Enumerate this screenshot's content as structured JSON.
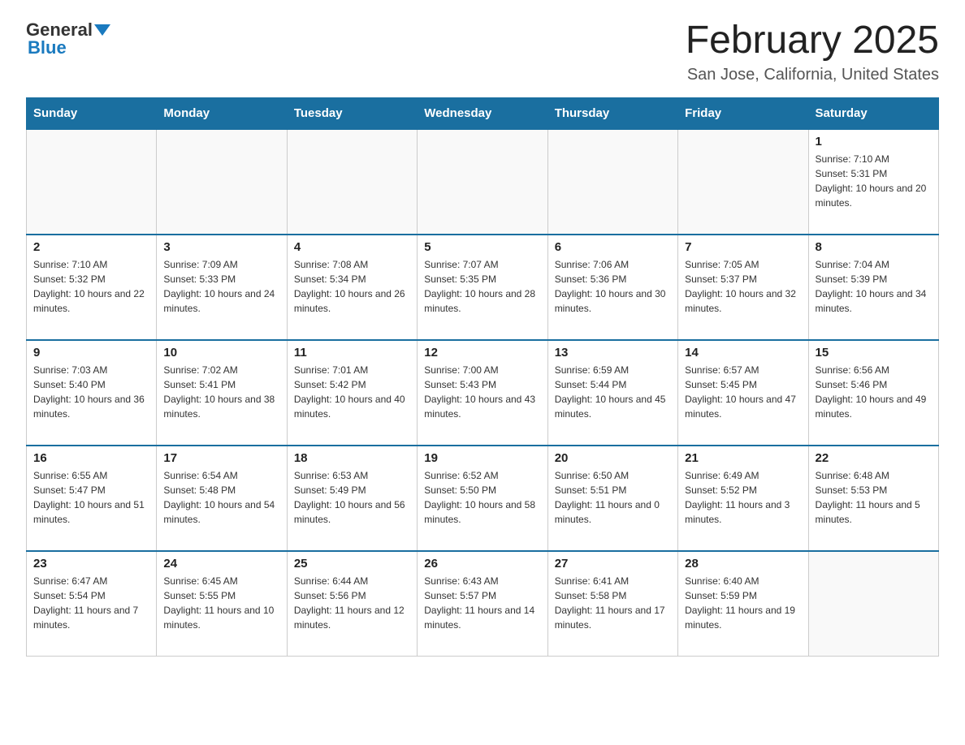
{
  "logo": {
    "general": "General",
    "triangle": "",
    "blue_label": "Blue"
  },
  "title": "February 2025",
  "subtitle": "San Jose, California, United States",
  "days_of_week": [
    "Sunday",
    "Monday",
    "Tuesday",
    "Wednesday",
    "Thursday",
    "Friday",
    "Saturday"
  ],
  "weeks": [
    [
      {
        "day": "",
        "sunrise": "",
        "sunset": "",
        "daylight": ""
      },
      {
        "day": "",
        "sunrise": "",
        "sunset": "",
        "daylight": ""
      },
      {
        "day": "",
        "sunrise": "",
        "sunset": "",
        "daylight": ""
      },
      {
        "day": "",
        "sunrise": "",
        "sunset": "",
        "daylight": ""
      },
      {
        "day": "",
        "sunrise": "",
        "sunset": "",
        "daylight": ""
      },
      {
        "day": "",
        "sunrise": "",
        "sunset": "",
        "daylight": ""
      },
      {
        "day": "1",
        "sunrise": "Sunrise: 7:10 AM",
        "sunset": "Sunset: 5:31 PM",
        "daylight": "Daylight: 10 hours and 20 minutes."
      }
    ],
    [
      {
        "day": "2",
        "sunrise": "Sunrise: 7:10 AM",
        "sunset": "Sunset: 5:32 PM",
        "daylight": "Daylight: 10 hours and 22 minutes."
      },
      {
        "day": "3",
        "sunrise": "Sunrise: 7:09 AM",
        "sunset": "Sunset: 5:33 PM",
        "daylight": "Daylight: 10 hours and 24 minutes."
      },
      {
        "day": "4",
        "sunrise": "Sunrise: 7:08 AM",
        "sunset": "Sunset: 5:34 PM",
        "daylight": "Daylight: 10 hours and 26 minutes."
      },
      {
        "day": "5",
        "sunrise": "Sunrise: 7:07 AM",
        "sunset": "Sunset: 5:35 PM",
        "daylight": "Daylight: 10 hours and 28 minutes."
      },
      {
        "day": "6",
        "sunrise": "Sunrise: 7:06 AM",
        "sunset": "Sunset: 5:36 PM",
        "daylight": "Daylight: 10 hours and 30 minutes."
      },
      {
        "day": "7",
        "sunrise": "Sunrise: 7:05 AM",
        "sunset": "Sunset: 5:37 PM",
        "daylight": "Daylight: 10 hours and 32 minutes."
      },
      {
        "day": "8",
        "sunrise": "Sunrise: 7:04 AM",
        "sunset": "Sunset: 5:39 PM",
        "daylight": "Daylight: 10 hours and 34 minutes."
      }
    ],
    [
      {
        "day": "9",
        "sunrise": "Sunrise: 7:03 AM",
        "sunset": "Sunset: 5:40 PM",
        "daylight": "Daylight: 10 hours and 36 minutes."
      },
      {
        "day": "10",
        "sunrise": "Sunrise: 7:02 AM",
        "sunset": "Sunset: 5:41 PM",
        "daylight": "Daylight: 10 hours and 38 minutes."
      },
      {
        "day": "11",
        "sunrise": "Sunrise: 7:01 AM",
        "sunset": "Sunset: 5:42 PM",
        "daylight": "Daylight: 10 hours and 40 minutes."
      },
      {
        "day": "12",
        "sunrise": "Sunrise: 7:00 AM",
        "sunset": "Sunset: 5:43 PM",
        "daylight": "Daylight: 10 hours and 43 minutes."
      },
      {
        "day": "13",
        "sunrise": "Sunrise: 6:59 AM",
        "sunset": "Sunset: 5:44 PM",
        "daylight": "Daylight: 10 hours and 45 minutes."
      },
      {
        "day": "14",
        "sunrise": "Sunrise: 6:57 AM",
        "sunset": "Sunset: 5:45 PM",
        "daylight": "Daylight: 10 hours and 47 minutes."
      },
      {
        "day": "15",
        "sunrise": "Sunrise: 6:56 AM",
        "sunset": "Sunset: 5:46 PM",
        "daylight": "Daylight: 10 hours and 49 minutes."
      }
    ],
    [
      {
        "day": "16",
        "sunrise": "Sunrise: 6:55 AM",
        "sunset": "Sunset: 5:47 PM",
        "daylight": "Daylight: 10 hours and 51 minutes."
      },
      {
        "day": "17",
        "sunrise": "Sunrise: 6:54 AM",
        "sunset": "Sunset: 5:48 PM",
        "daylight": "Daylight: 10 hours and 54 minutes."
      },
      {
        "day": "18",
        "sunrise": "Sunrise: 6:53 AM",
        "sunset": "Sunset: 5:49 PM",
        "daylight": "Daylight: 10 hours and 56 minutes."
      },
      {
        "day": "19",
        "sunrise": "Sunrise: 6:52 AM",
        "sunset": "Sunset: 5:50 PM",
        "daylight": "Daylight: 10 hours and 58 minutes."
      },
      {
        "day": "20",
        "sunrise": "Sunrise: 6:50 AM",
        "sunset": "Sunset: 5:51 PM",
        "daylight": "Daylight: 11 hours and 0 minutes."
      },
      {
        "day": "21",
        "sunrise": "Sunrise: 6:49 AM",
        "sunset": "Sunset: 5:52 PM",
        "daylight": "Daylight: 11 hours and 3 minutes."
      },
      {
        "day": "22",
        "sunrise": "Sunrise: 6:48 AM",
        "sunset": "Sunset: 5:53 PM",
        "daylight": "Daylight: 11 hours and 5 minutes."
      }
    ],
    [
      {
        "day": "23",
        "sunrise": "Sunrise: 6:47 AM",
        "sunset": "Sunset: 5:54 PM",
        "daylight": "Daylight: 11 hours and 7 minutes."
      },
      {
        "day": "24",
        "sunrise": "Sunrise: 6:45 AM",
        "sunset": "Sunset: 5:55 PM",
        "daylight": "Daylight: 11 hours and 10 minutes."
      },
      {
        "day": "25",
        "sunrise": "Sunrise: 6:44 AM",
        "sunset": "Sunset: 5:56 PM",
        "daylight": "Daylight: 11 hours and 12 minutes."
      },
      {
        "day": "26",
        "sunrise": "Sunrise: 6:43 AM",
        "sunset": "Sunset: 5:57 PM",
        "daylight": "Daylight: 11 hours and 14 minutes."
      },
      {
        "day": "27",
        "sunrise": "Sunrise: 6:41 AM",
        "sunset": "Sunset: 5:58 PM",
        "daylight": "Daylight: 11 hours and 17 minutes."
      },
      {
        "day": "28",
        "sunrise": "Sunrise: 6:40 AM",
        "sunset": "Sunset: 5:59 PM",
        "daylight": "Daylight: 11 hours and 19 minutes."
      },
      {
        "day": "",
        "sunrise": "",
        "sunset": "",
        "daylight": ""
      }
    ]
  ]
}
